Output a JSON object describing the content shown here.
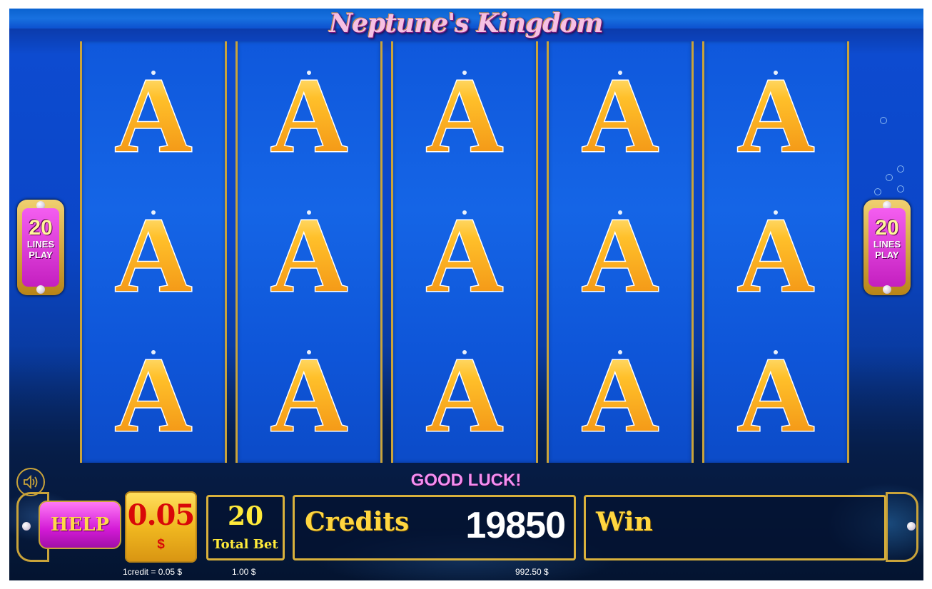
{
  "game": {
    "title": "Neptune's Kingdom",
    "status_message": "GOOD LUCK!",
    "symbol": "A",
    "reels": [
      [
        "A",
        "A",
        "A"
      ],
      [
        "A",
        "A",
        "A"
      ],
      [
        "A",
        "A",
        "A"
      ],
      [
        "A",
        "A",
        "A"
      ],
      [
        "A",
        "A",
        "A"
      ]
    ],
    "lines_left": {
      "number": "20",
      "label1": "LINES",
      "label2": "PLAY"
    },
    "lines_right": {
      "number": "20",
      "label1": "LINES",
      "label2": "PLAY"
    }
  },
  "controls": {
    "sound_icon": "speaker-icon",
    "help_label": "HELP",
    "denomination": {
      "value": "0.05",
      "currency": "$"
    },
    "credit_note": "1credit = 0.05 $",
    "total_bet": {
      "value": "20",
      "label": "Total Bet",
      "amount": "1.00 $"
    },
    "credits": {
      "label": "Credits",
      "value": "19850",
      "amount": "992.50 $"
    },
    "win": {
      "label": "Win",
      "value": ""
    }
  },
  "colors": {
    "accent_gold": "#d9b13c",
    "help_pink": "#d31ad6",
    "denom_red": "#d80808"
  }
}
